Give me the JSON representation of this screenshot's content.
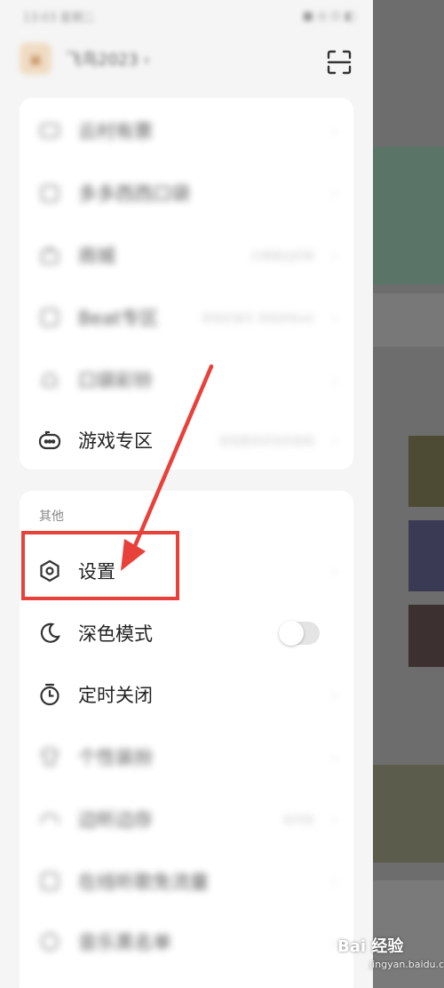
{
  "status_bar": {
    "time": "13:03 星期二",
    "battery": "■ ◎ ⊡ ◧"
  },
  "profile": {
    "name": "飞鸟2023 ›"
  },
  "menu_top": [
    {
      "label": "云村有票",
      "sub": "",
      "icon": "ticket-icon"
    },
    {
      "label": "多多西西口袋",
      "sub": "",
      "icon": "shop-icon"
    },
    {
      "label": "商城",
      "sub": "大牌周边好物",
      "icon": "bag-icon"
    },
    {
      "label": "Beat专区",
      "sub": "发现好音乐 发现好Beat",
      "icon": "beat-icon"
    },
    {
      "label": "口袋彩铃",
      "sub": "",
      "icon": "bell-icon"
    },
    {
      "label": "游戏专区",
      "sub": "发现更多好玩的游戏",
      "icon": "game-icon"
    }
  ],
  "section_other": {
    "title": "其他"
  },
  "menu_bottom": [
    {
      "label": "设置",
      "icon": "settings-icon"
    },
    {
      "label": "深色模式",
      "icon": "moon-icon"
    },
    {
      "label": "定时关闭",
      "icon": "timer-icon"
    },
    {
      "label": "个性装扮",
      "icon": "shirt-icon"
    },
    {
      "label": "边听边存",
      "sub": "未开启",
      "icon": "headphones-icon"
    },
    {
      "label": "在线听歌免流量",
      "icon": "data-icon"
    },
    {
      "label": "音乐黑名单",
      "icon": "block-icon"
    }
  ],
  "toggles": {
    "dark_mode_on": false
  },
  "watermark": {
    "text": "Bai 经验",
    "sub": "jingyan.baidu.com"
  },
  "colors": {
    "highlight": "#e8413a",
    "card": "#ffffff",
    "drawer_bg": "#f5f5f5"
  }
}
